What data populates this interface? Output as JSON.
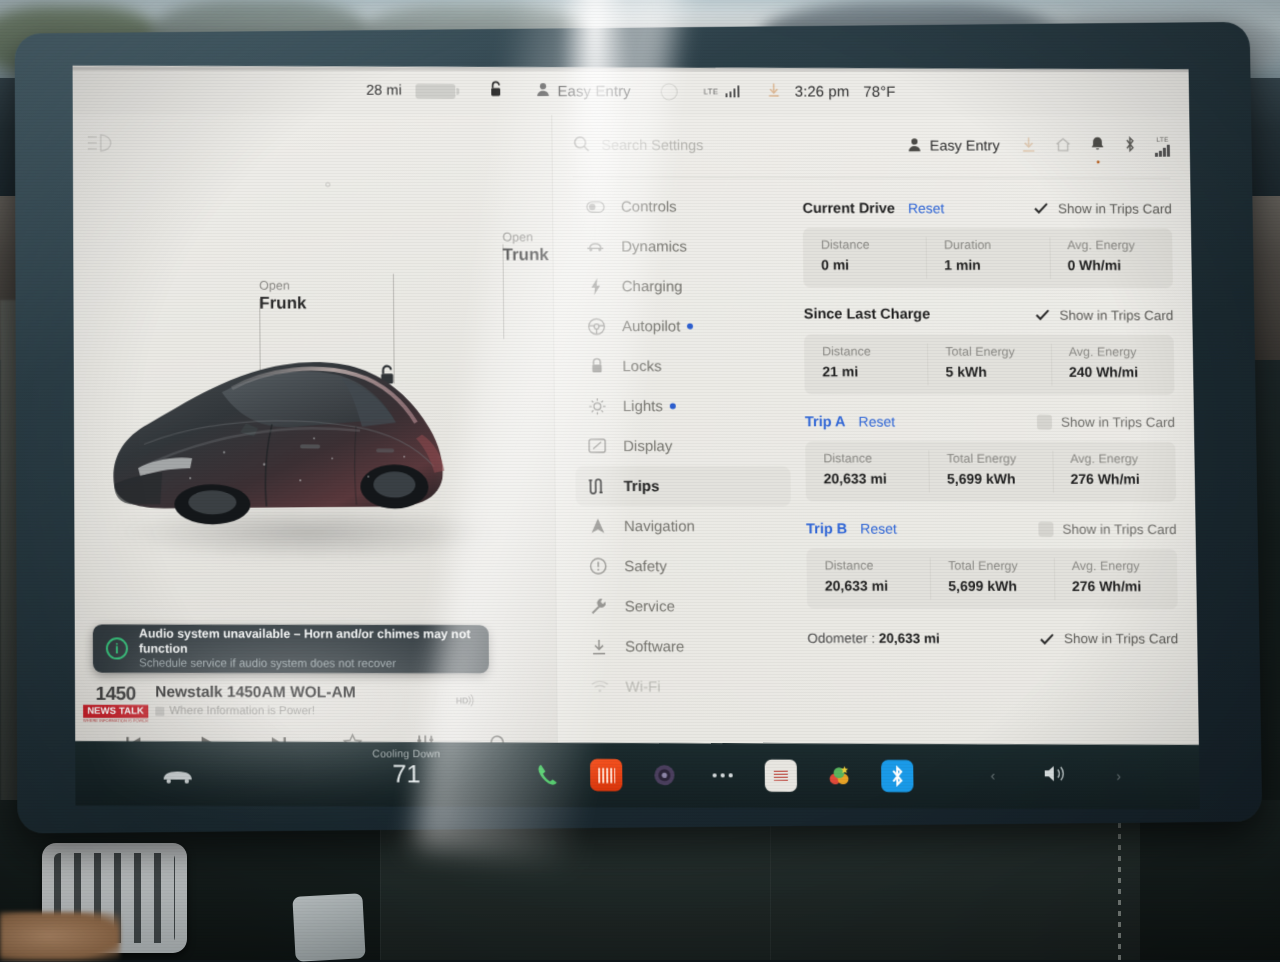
{
  "status_bar": {
    "range": "28 mi",
    "battery_icon": "battery-icon",
    "lock_icon": "unlocked-padlock-icon",
    "profile_icon": "person-icon",
    "profile_name": "Easy Entry",
    "circle_icon": "circle-icon",
    "lte_label": "LTE",
    "signal_icon": "signal-bars-icon",
    "download_icon": "download-icon",
    "time": "3:26 pm",
    "temperature": "78°F"
  },
  "left_pane": {
    "beam_icon": "headlight-beam-icon",
    "hotspots": [
      {
        "action": "Open",
        "target": "Frunk",
        "name": "frunk-hotspot"
      },
      {
        "action": "Open",
        "target": "Trunk",
        "name": "trunk-hotspot"
      }
    ],
    "lock_icon": "unlocked-padlock-icon",
    "charge_port_icon": "charge-bolt-icon",
    "vehicle_image": "tesla-model-y-render",
    "notification": {
      "icon": "info-icon",
      "title": "Audio system unavailable – Horn and/or chimes may not function",
      "subtitle": "Schedule service if audio system does not recover"
    },
    "media": {
      "logo_number": "1450",
      "logo_tag": "NEWS TALK",
      "logo_sub": "WHERE INFORMATION IS POWER",
      "title": "Newstalk 1450AM  WOL-AM",
      "subtitle": "Where Information is Power!",
      "hd_badge": "HD",
      "controls": [
        {
          "name": "previous-track-button",
          "icon": "skip-previous-icon"
        },
        {
          "name": "play-button",
          "icon": "play-icon"
        },
        {
          "name": "next-track-button",
          "icon": "skip-next-icon"
        },
        {
          "name": "favorite-button",
          "icon": "star-icon"
        },
        {
          "name": "equalizer-button",
          "icon": "sliders-icon"
        },
        {
          "name": "media-search-button",
          "icon": "search-icon"
        }
      ]
    }
  },
  "settings": {
    "search": {
      "placeholder": "Search Settings",
      "value": "",
      "icon": "search-icon"
    },
    "profile_name": "Easy Entry",
    "header_icons": [
      {
        "name": "download-icon",
        "dimmed": true
      },
      {
        "name": "home-icon",
        "dimmed": true
      },
      {
        "name": "bell-icon",
        "dimmed": false
      },
      {
        "name": "bluetooth-icon",
        "dimmed": false
      },
      {
        "name": "lte-signal-icon",
        "dimmed": false,
        "label": "LTE"
      }
    ],
    "nav_items": [
      {
        "label": "Controls",
        "icon": "toggle-icon",
        "active": false,
        "dot": false
      },
      {
        "label": "Dynamics",
        "icon": "car-dynamics-icon",
        "active": false,
        "dot": false
      },
      {
        "label": "Charging",
        "icon": "bolt-icon",
        "active": false,
        "dot": false
      },
      {
        "label": "Autopilot",
        "icon": "steering-wheel-icon",
        "active": false,
        "dot": true
      },
      {
        "label": "Locks",
        "icon": "lock-icon",
        "active": false,
        "dot": false
      },
      {
        "label": "Lights",
        "icon": "light-icon",
        "active": false,
        "dot": true
      },
      {
        "label": "Display",
        "icon": "display-icon",
        "active": false,
        "dot": false
      },
      {
        "label": "Trips",
        "icon": "trips-route-icon",
        "active": true,
        "dot": false
      },
      {
        "label": "Navigation",
        "icon": "navigation-arrow-icon",
        "active": false,
        "dot": false
      },
      {
        "label": "Safety",
        "icon": "safety-alert-icon",
        "active": false,
        "dot": false
      },
      {
        "label": "Service",
        "icon": "wrench-icon",
        "active": false,
        "dot": false
      },
      {
        "label": "Software",
        "icon": "download-icon",
        "active": false,
        "dot": false
      },
      {
        "label": "Wi-Fi",
        "icon": "wifi-icon",
        "active": false,
        "dot": false
      }
    ],
    "show_in_trips_card_label": "Show in Trips Card",
    "reset_label": "Reset",
    "sections": [
      {
        "title": "Current Drive",
        "title_is_link": false,
        "has_reset": true,
        "checked": true,
        "cells": [
          {
            "key": "Distance",
            "value": "0 mi"
          },
          {
            "key": "Duration",
            "value": "1 min"
          },
          {
            "key": "Avg. Energy",
            "value": "0 Wh/mi"
          }
        ]
      },
      {
        "title": "Since Last Charge",
        "title_is_link": false,
        "has_reset": false,
        "checked": true,
        "cells": [
          {
            "key": "Distance",
            "value": "21 mi"
          },
          {
            "key": "Total Energy",
            "value": "5 kWh"
          },
          {
            "key": "Avg. Energy",
            "value": "240 Wh/mi"
          }
        ]
      },
      {
        "title": "Trip A",
        "title_is_link": true,
        "has_reset": true,
        "checked": false,
        "cells": [
          {
            "key": "Distance",
            "value": "20,633 mi"
          },
          {
            "key": "Total Energy",
            "value": "5,699 kWh"
          },
          {
            "key": "Avg. Energy",
            "value": "276 Wh/mi"
          }
        ]
      },
      {
        "title": "Trip B",
        "title_is_link": true,
        "has_reset": true,
        "checked": false,
        "cells": [
          {
            "key": "Distance",
            "value": "20,633 mi"
          },
          {
            "key": "Total Energy",
            "value": "5,699 kWh"
          },
          {
            "key": "Avg. Energy",
            "value": "276 Wh/mi"
          }
        ]
      }
    ],
    "odometer": {
      "label": "Odometer :",
      "value": "20,633 mi",
      "checked": true
    }
  },
  "taskbar": {
    "car_icon": "car-icon",
    "climate_status": "Cooling Down",
    "climate_temp": "71",
    "apps": [
      {
        "name": "phone-app-icon",
        "glyph": "✆"
      },
      {
        "name": "media-app-icon",
        "glyph": ""
      },
      {
        "name": "camera-app-icon",
        "glyph": "◉"
      },
      {
        "name": "more-apps-icon",
        "glyph": "•••"
      },
      {
        "name": "cards-app-icon",
        "glyph": ""
      },
      {
        "name": "toybox-app-icon",
        "glyph": ""
      },
      {
        "name": "bluetooth-app-icon",
        "glyph": "ᛦ"
      }
    ],
    "volume_icon": "volume-icon",
    "volume_prev": "‹",
    "volume_next": "›"
  },
  "colors": {
    "accent_blue": "#2f66d8",
    "screen_bg": "#ecebe7",
    "card_bg": "#e2e1dc",
    "taskbar_bg": "#172629",
    "notification_bg": "#313a3f",
    "notification_accent": "#35c07a"
  }
}
